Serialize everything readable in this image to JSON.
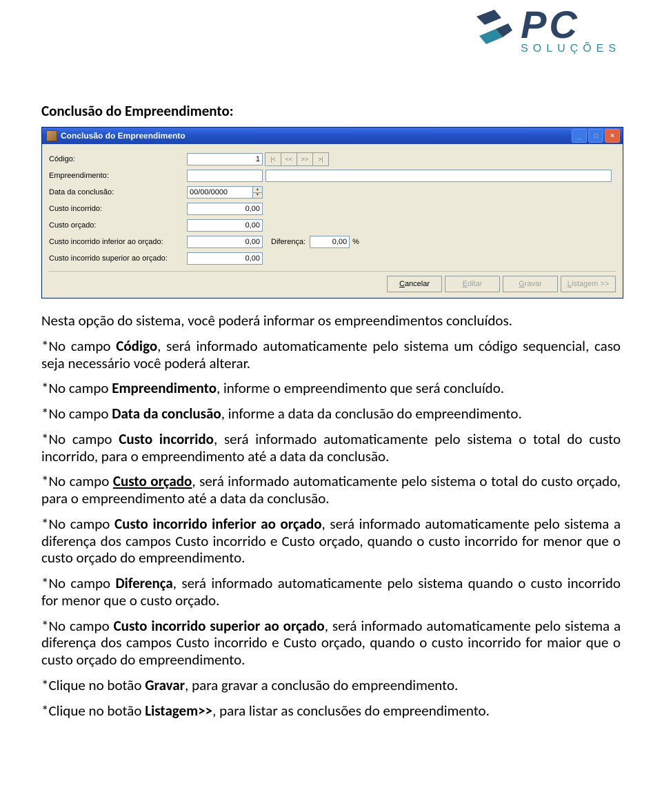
{
  "logo": {
    "brand": "PC",
    "subtitle": "SOLUÇÕES"
  },
  "section_title": "Conclusão do Empreendimento:",
  "window": {
    "title": "Conclusão do Empreendimento",
    "labels": {
      "codigo": "Código:",
      "empreendimento": "Empreendimento:",
      "data_conclusao": "Data da conclusão:",
      "custo_incorrido": "Custo incorrido:",
      "custo_orcado": "Custo orçado:",
      "custo_inf": "Custo incorrido inferior ao orçado:",
      "custo_sup": "Custo incorrido superior ao orçado:",
      "diferenca": "Diferença:",
      "percent": "%"
    },
    "values": {
      "codigo": "1",
      "data": "00/00/0000",
      "custo_incorrido": "0,00",
      "custo_orcado": "0,00",
      "custo_inf": "0,00",
      "custo_sup": "0,00",
      "diferenca": "0,00"
    },
    "nav": {
      "first": "|<",
      "prev": "<<",
      "next": ">>",
      "last": ">|"
    },
    "buttons": {
      "cancelar": "Cancelar",
      "editar": "Editar",
      "gravar": "Gravar",
      "listagem": "Listagem >>"
    }
  },
  "paragraphs": {
    "intro": "Nesta opção do sistema, você poderá informar os empreendimentos concluídos.",
    "p1": {
      "lead": "*No campo ",
      "bold": "Código",
      "rest": ", será informado automaticamente pelo sistema um código sequencial, caso seja necessário você poderá alterar."
    },
    "p2": {
      "lead": "*No campo ",
      "bold": "Empreendimento",
      "rest": ", informe o empreendimento que será concluído."
    },
    "p3": {
      "lead": "*No campo ",
      "bold": "Data da conclusão",
      "rest": ", informe a data da conclusão do empreendimento."
    },
    "p4": {
      "lead": "*No campo ",
      "bold": "Custo incorrido",
      "rest": ", será informado automaticamente pelo sistema o total do custo incorrido, para o empreendimento até a data da conclusão."
    },
    "p5": {
      "lead": "*No campo ",
      "bold": "Custo orçado",
      "rest": ", será informado automaticamente pelo sistema o total do custo orçado, para o empreendimento até a data da conclusão."
    },
    "p6": {
      "lead": "*No campo ",
      "bold": "Custo incorrido inferior ao orçado",
      "rest": ", será informado automaticamente pelo sistema a diferença dos campos Custo incorrido e Custo orçado, quando o custo incorrido for menor que o custo orçado do empreendimento."
    },
    "p7": {
      "lead": "*No campo ",
      "bold": "Diferença",
      "rest": ", será informado automaticamente pelo sistema quando o custo incorrido for menor que o custo orçado."
    },
    "p8": {
      "lead": "*No campo ",
      "bold": "Custo incorrido superior ao orçado",
      "rest": ", será informado automaticamente pelo sistema a diferença dos campos Custo incorrido e Custo orçado, quando o custo incorrido for maior que o custo orçado do empreendimento."
    },
    "p9": {
      "lead": "*Clique no botão ",
      "bold": "Gravar",
      "rest": ", para gravar a conclusão do empreendimento."
    },
    "p10": {
      "lead": "*Clique no botão ",
      "bold": "Listagem>>",
      "rest": ", para listar as conclusões do empreendimento."
    }
  }
}
